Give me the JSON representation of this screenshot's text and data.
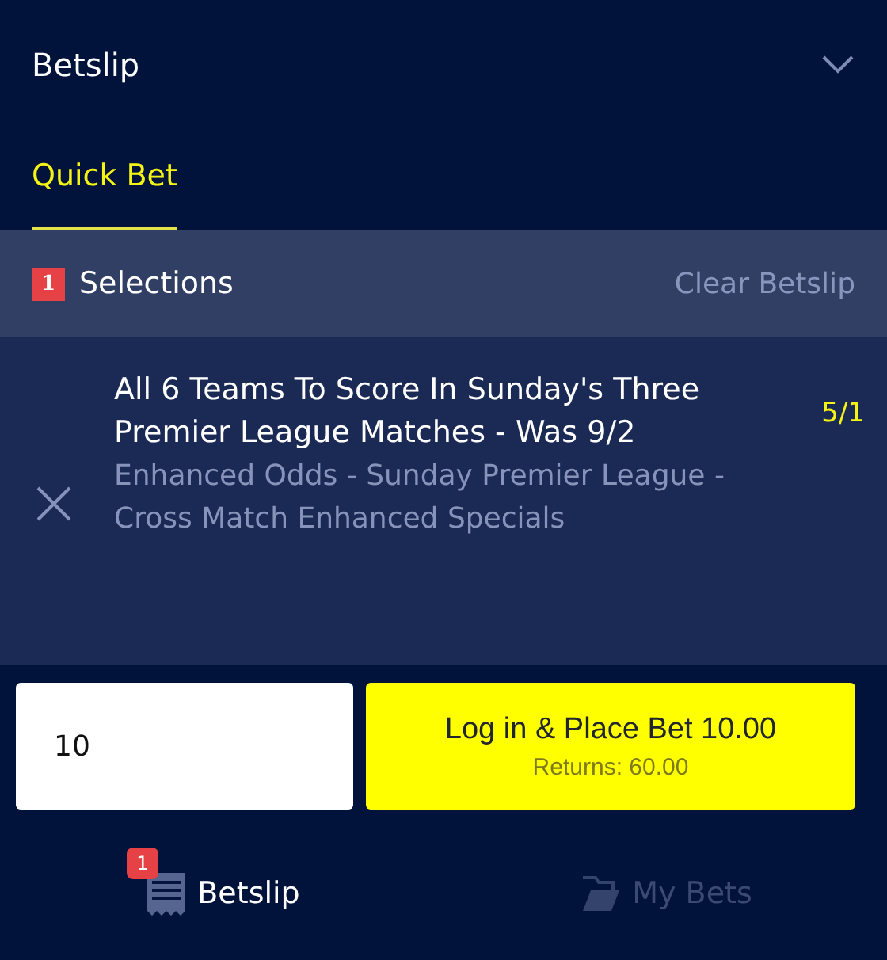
{
  "header": {
    "title": "Betslip"
  },
  "tabs": [
    {
      "label": "Quick Bet",
      "selected": true
    }
  ],
  "selections_bar": {
    "count": "1",
    "label": "Selections",
    "clear": "Clear Betslip"
  },
  "selections": [
    {
      "title": "All 6 Teams To Score In Sunday's Three Premier League Matches - Was 9/2",
      "odds": "5/1",
      "market": "Enhanced Odds - Sunday Premier League - Cross Match Enhanced Specials"
    }
  ],
  "stake": {
    "value": "10"
  },
  "place_bet": {
    "label": "Log in & Place Bet 10.00",
    "returns": "Returns:  60.00"
  },
  "bottom_nav": [
    {
      "label": "Betslip",
      "badge": "1",
      "selected": true,
      "kind": "slip"
    },
    {
      "label": "My Bets",
      "selected": false,
      "kind": "bets"
    }
  ]
}
